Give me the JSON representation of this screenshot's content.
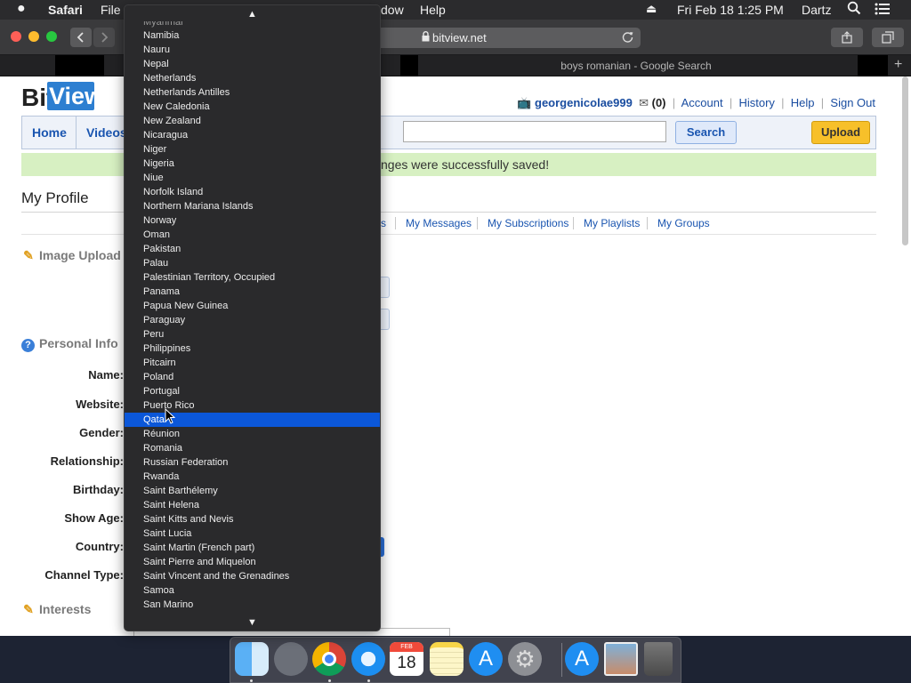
{
  "menubar": {
    "app_name": "Safari",
    "file": "File",
    "window_fragment": "dow",
    "help": "Help",
    "clock": "Fri Feb 18  1:25 PM",
    "user": "Dartz"
  },
  "browser": {
    "address": "bitview.net",
    "tab_active": "boys romanian - Google Search"
  },
  "site": {
    "logo_bit": "Bit",
    "logo_view": "View",
    "username": "georgenicolae999",
    "inbox_count": "(0)",
    "user_links": [
      "Account",
      "History",
      "Help",
      "Sign Out"
    ],
    "nav_home": "Home",
    "nav_videos": "Videos",
    "search_button": "Search",
    "upload_button": "Upload",
    "success_message": "nges were successfully saved!",
    "profile_title": "My Profile",
    "subnav": [
      "s",
      "My Messages",
      "My Subscriptions",
      "My Playlists",
      "My Groups"
    ],
    "section_image": "Image Upload",
    "section_personal": "Personal Info",
    "section_interests": "Interests",
    "labels": [
      "Name:",
      "Website:",
      "Gender:",
      "Relationship:",
      "Birthday:",
      "Show Age:",
      "Country:",
      "Channel Type:"
    ]
  },
  "dropdown": {
    "up_arrow": "▲",
    "down_arrow": "▼",
    "cut_item": "Myanmar",
    "selected": "Qatar",
    "options": [
      "Namibia",
      "Nauru",
      "Nepal",
      "Netherlands",
      "Netherlands Antilles",
      "New Caledonia",
      "New Zealand",
      "Nicaragua",
      "Niger",
      "Nigeria",
      "Niue",
      "Norfolk Island",
      "Northern Mariana Islands",
      "Norway",
      "Oman",
      "Pakistan",
      "Palau",
      "Palestinian Territory, Occupied",
      "Panama",
      "Papua New Guinea",
      "Paraguay",
      "Peru",
      "Philippines",
      "Pitcairn",
      "Poland",
      "Portugal",
      "Puerto Rico",
      "Qatar",
      "Réunion",
      "Romania",
      "Russian Federation",
      "Rwanda",
      "Saint Barthélemy",
      "Saint Helena",
      "Saint Kitts and Nevis",
      "Saint Lucia",
      "Saint Martin (French part)",
      "Saint Pierre and Miquelon",
      "Saint Vincent and the Grenadines",
      "Samoa",
      "San Marino"
    ]
  },
  "dock": {
    "calendar_month": "FEB",
    "calendar_day": "18",
    "apps": [
      "Finder",
      "Launchpad",
      "Chrome",
      "Safari",
      "Calendar",
      "Notes",
      "App Store",
      "System Preferences",
      "Downloads",
      "Preview",
      "Trash"
    ]
  },
  "colors": {
    "selection": "#0b57d9",
    "link": "#1a55b0",
    "upload": "#f7c02a",
    "success_bg": "#d7f0c2"
  }
}
